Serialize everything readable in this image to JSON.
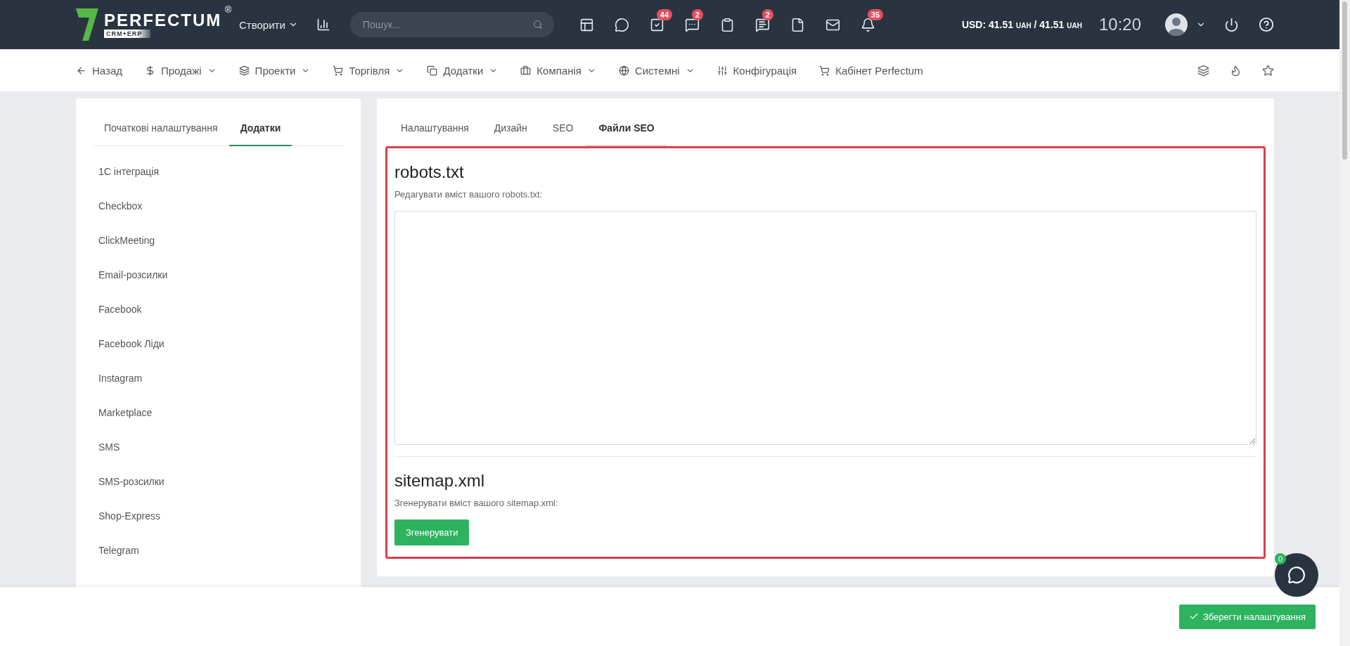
{
  "header": {
    "logo": {
      "name": "PERFECTUM",
      "registered": "®",
      "tagline": "CRM+ERP"
    },
    "create_menu": "Створити",
    "search": {
      "placeholder": "Пошук..."
    },
    "icons": [
      {
        "kind": "layout"
      },
      {
        "kind": "chat"
      },
      {
        "kind": "tasks",
        "badge": "44"
      },
      {
        "kind": "comments",
        "badge": "2"
      },
      {
        "kind": "clipboard"
      },
      {
        "kind": "messages",
        "badge": "2"
      },
      {
        "kind": "file"
      },
      {
        "kind": "mail"
      },
      {
        "kind": "bell",
        "badge": "35"
      }
    ],
    "currency": {
      "label": "USD:",
      "values": [
        {
          "amount": "41.51",
          "unit": "UAH"
        },
        {
          "amount": "41.51",
          "unit": "UAH"
        }
      ],
      "separator": "/"
    },
    "time": "10:20"
  },
  "nav": {
    "items": [
      {
        "kind": "back",
        "label": "Назад",
        "dropdown": false
      },
      {
        "kind": "dollar",
        "label": "Продажі",
        "dropdown": true
      },
      {
        "kind": "layers",
        "label": "Проекти",
        "dropdown": true
      },
      {
        "kind": "cart",
        "label": "Торгівля",
        "dropdown": true
      },
      {
        "kind": "copy",
        "label": "Додатки",
        "dropdown": true
      },
      {
        "kind": "briefcase",
        "label": "Компанія",
        "dropdown": true
      },
      {
        "kind": "globe",
        "label": "Системні",
        "dropdown": true
      },
      {
        "kind": "sliders",
        "label": "Конфігурація",
        "dropdown": false
      },
      {
        "kind": "cart",
        "label": "Кабінет Perfectum",
        "dropdown": false
      }
    ],
    "tools": [
      {
        "kind": "layers"
      },
      {
        "kind": "flame"
      },
      {
        "kind": "star"
      }
    ]
  },
  "sidebar": {
    "tabs": [
      {
        "label": "Початкові налаштування",
        "selected": false
      },
      {
        "label": "Додатки",
        "selected": true
      }
    ],
    "items": [
      "1С інтеграція",
      "Checkbox",
      "ClickMeeting",
      "Email-розсилки",
      "Facebook",
      "Facebook Ліди",
      "Instagram",
      "Marketplace",
      "SMS",
      "SMS-розсилки",
      "Shop-Express",
      "Telegram"
    ]
  },
  "main": {
    "tabs": [
      {
        "label": "Налаштування",
        "selected": false
      },
      {
        "label": "Дизайн",
        "selected": false
      },
      {
        "label": "SEO",
        "selected": false
      },
      {
        "label": "Файли SEO",
        "selected": true
      }
    ],
    "robots": {
      "title": "robots.txt",
      "description": "Редагувати вміст вашого robots.txt:"
    },
    "sitemap": {
      "title": "sitemap.xml",
      "description": "Згенерувати вміст вашого sitemap.xml:",
      "button": "Згенерувати"
    }
  },
  "footer": {
    "save_button": "Зберегти налаштування"
  },
  "chat": {
    "badge": "0"
  }
}
